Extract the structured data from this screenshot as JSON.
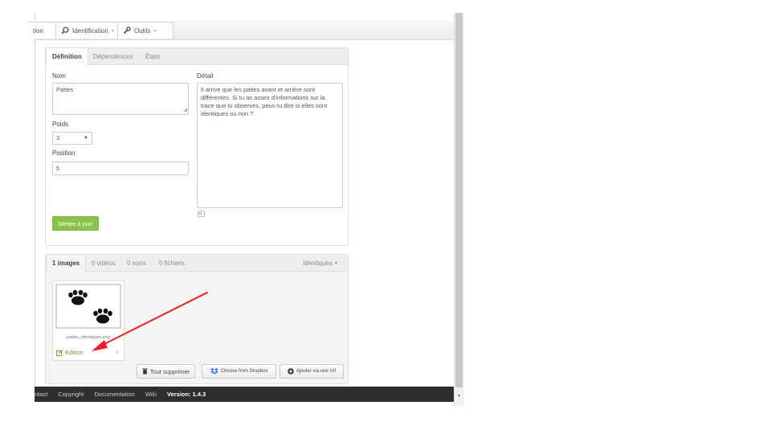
{
  "menubar": {
    "partial_tab": "tion",
    "identification_tab": "Identification",
    "outils_tab": "Outils"
  },
  "definition_panel": {
    "tabs": [
      "Définition",
      "Dépendences",
      "États"
    ],
    "nom_label": "Nom",
    "nom_value": "Pattes",
    "poids_label": "Poids",
    "poids_value": "3",
    "position_label": "Position",
    "position_value": "5",
    "detail_label": "Détail",
    "detail_value": "Il arrive que les pattes avant et arrière sont différentes. Si tu as assez d'informations sur la trace que tu observes, peux-tu dire si elles sont identiques ou non ?",
    "update_button": "Mettre à jour"
  },
  "media_panel": {
    "tabs": [
      "1 images",
      "0 vidéos",
      "0 sons",
      "0 fichiers"
    ],
    "filter_dropdown": "Identiques",
    "image_filename": "pattes_identiques.png",
    "edit_link": "Edition",
    "delete_all_button": "Tout supprimer",
    "dropbox_button": "Choose from Dropbox",
    "add_url_button": "Ajouter via une Url"
  },
  "footer": {
    "items": [
      "ntact",
      "Copyright",
      "Documentation",
      "Wiki"
    ],
    "version": "Version: 1.4.3"
  },
  "colors": {
    "accent_green": "#8bc34a",
    "annotation_arrow": "#e8202a",
    "footer_bg": "#2e2e2e"
  },
  "icons": {
    "identification": "search-icon",
    "outils": "wrench-icon",
    "edit": "edit-icon",
    "delete": "close-icon",
    "delete_all": "trash-icon",
    "dropbox": "dropbox-icon",
    "add_url": "plus-circle-icon",
    "markdown": "markdown-icon"
  }
}
